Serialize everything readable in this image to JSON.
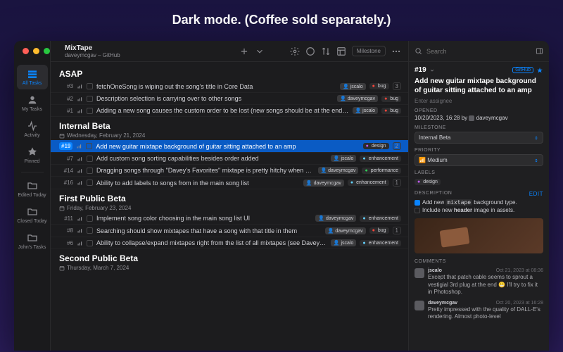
{
  "headline": "Dark mode. (Coffee sold separately.)",
  "project": {
    "name": "MixTape",
    "sub": "daveymcgav – GitHub"
  },
  "toolbar": {
    "milestone_btn": "Milestone"
  },
  "sidebar": {
    "items": [
      {
        "label": "All Tasks"
      },
      {
        "label": "My Tasks"
      },
      {
        "label": "Activity"
      },
      {
        "label": "Pinned"
      },
      {
        "label": "Edited Today"
      },
      {
        "label": "Closed Today"
      },
      {
        "label": "John's Tasks"
      }
    ]
  },
  "milestones": [
    {
      "title": "ASAP",
      "tasks": [
        {
          "num": "#3",
          "title": "fetchOneSong is wiping out the song's title in Core Data",
          "user": "jscalo",
          "label": "bug",
          "count": "3"
        },
        {
          "num": "#2",
          "title": "Description selection is carrying over to other songs",
          "user": "daveymcgav",
          "label": "bug"
        },
        {
          "num": "#1",
          "title": "Adding a new song causes the custom order to be lost (new songs should be at the end of the added list)",
          "user": "jscalo",
          "label": "bug"
        }
      ]
    },
    {
      "title": "Internal Beta",
      "date": "Wednesday, February 21, 2024",
      "tasks": [
        {
          "num": "#19",
          "title": "Add new guitar mixtape background of guitar sitting attached to an amp",
          "label": "design",
          "selected": true,
          "count": "2"
        },
        {
          "num": "#7",
          "title": "Add custom song sorting capabilities besides order added",
          "user": "jscalo",
          "label": "enhancement"
        },
        {
          "num": "#14",
          "title": "Dragging songs through \"Davey's Favorites\" mixtape is pretty hitchy when viewing on iPad (but not iPhone)",
          "user": "daveymcgav",
          "label": "performance"
        },
        {
          "num": "#16",
          "title": "Ability to add labels to songs from in the main song list",
          "user": "daveymcgav",
          "label": "enhancement",
          "count": "1"
        }
      ]
    },
    {
      "title": "First Public Beta",
      "date": "Friday, February 23, 2024",
      "tasks": [
        {
          "num": "#11",
          "title": "Implement song color choosing in the main song list UI",
          "user": "daveymcgav",
          "label": "enhancement"
        },
        {
          "num": "#8",
          "title": "Searching should show mixtapes that have a song with that title in them",
          "user": "daveymcgav",
          "label": "bug",
          "count": "1"
        },
        {
          "num": "#6",
          "title": "Ability to collapse/expand mixtapes right from the list of all mixtapes (see Davey's designs)",
          "user": "jscalo",
          "label": "enhancement"
        }
      ]
    },
    {
      "title": "Second Public Beta",
      "date": "Thursday, March 7, 2024",
      "tasks": []
    }
  ],
  "inspector": {
    "search_placeholder": "Search",
    "issue_num": "#19",
    "gh_label": "GitHub",
    "title": "Add new guitar mixtape background of guitar sitting attached to an amp",
    "assignee_placeholder": "Enter assignee",
    "opened_label": "OPENED",
    "opened_value": "10/20/2023, 16:28 by",
    "opened_by": "daveymcgav",
    "milestone_label": "MILESTONE",
    "milestone_value": "Internal Beta",
    "priority_label": "PRIORITY",
    "priority_value": "Medium",
    "labels_label": "LABELS",
    "labels_value": "design",
    "description_label": "DESCRIPTION",
    "edit_label": "Edit",
    "desc_line1_a": "Add new ",
    "desc_line1_code": "mixtape",
    "desc_line1_b": " background type.",
    "desc_line2_a": "Include new ",
    "desc_line2_b": "header",
    "desc_line2_c": " image in assets.",
    "comments_label": "COMMENTS",
    "comments": [
      {
        "user": "jscalo",
        "date": "Oct 21, 2023 at 08:36",
        "text": "Except that patch cable seems to sprout a vestigial 3rd plug at the end 😬 I'll try to fix it in Photoshop."
      },
      {
        "user": "daveymcgav",
        "date": "Oct 20, 2023 at 16:28",
        "text": "Pretty impressed with the quality of DALL-E's rendering. Almost photo-level"
      }
    ]
  }
}
